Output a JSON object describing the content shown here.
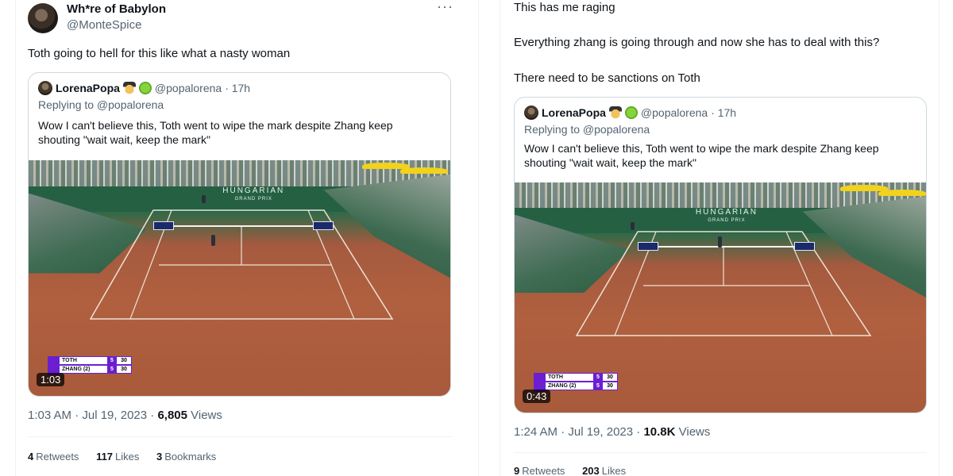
{
  "left_tweet": {
    "author_name": "Wh*re of Babylon",
    "author_handle": "@MonteSpice",
    "more_icon": "more-horizontal-icon",
    "text": "Toth going to hell for this like what a nasty woman",
    "quote": {
      "name": "LorenaPopa",
      "emojis": [
        "spy-emoji-icon",
        "tennis-ball-emoji-icon"
      ],
      "handle": "@popalorena",
      "time": "· 17h",
      "replying": "Replying to @popalorena",
      "body_line1": "Wow I can't believe this, Toth went to wipe the mark despite Zhang keep",
      "body_line2": "shouting \"wait wait, keep the mark\"",
      "video": {
        "banner_title": "HUNGARIAN",
        "banner_sub": "GRAND PRIX",
        "score": [
          {
            "player": "TOTH",
            "sets": "5",
            "points": "30"
          },
          {
            "player": "ZHANG (2)",
            "sets": "5",
            "points": "30"
          }
        ],
        "duration": "1:03"
      }
    },
    "timestamp": "1:03 AM · Jul 19, 2023 · ",
    "views_count": "6,805",
    "views_label": " Views",
    "retweets_count": "4",
    "retweets_label": "Retweets",
    "likes_count": "117",
    "likes_label": "Likes",
    "bookmarks_count": "3",
    "bookmarks_label": "Bookmarks"
  },
  "right_tweet": {
    "text_line1": "This has me raging",
    "text_line2": "Everything zhang is going through and now she has to deal with this?",
    "text_line3": "There need to be sanctions on Toth",
    "quote": {
      "name": "LorenaPopa",
      "emojis": [
        "spy-emoji-icon",
        "tennis-ball-emoji-icon"
      ],
      "handle": "@popalorena",
      "time": "· 17h",
      "replying": "Replying to @popalorena",
      "body_line1": "Wow I can't believe this, Toth went to wipe the mark despite Zhang keep",
      "body_line2": "shouting \"wait wait, keep the mark\"",
      "video": {
        "banner_title": "HUNGARIAN",
        "banner_sub": "GRAND PRIX",
        "score": [
          {
            "player": "TOTH",
            "sets": "5",
            "points": "30"
          },
          {
            "player": "ZHANG (2)",
            "sets": "5",
            "points": "30"
          }
        ],
        "duration": "0:43"
      }
    },
    "timestamp": "1:24 AM · Jul 19, 2023 · ",
    "views_count": "10.8K",
    "views_label": " Views",
    "retweets_count": "9",
    "retweets_label": "Retweets",
    "likes_count": "203",
    "likes_label": "Likes"
  },
  "colors": {
    "text_primary": "#0f1419",
    "text_secondary": "#536471",
    "border": "#cfd9de",
    "score_purple": "#6b1fd1",
    "clay": "#b0603f"
  }
}
